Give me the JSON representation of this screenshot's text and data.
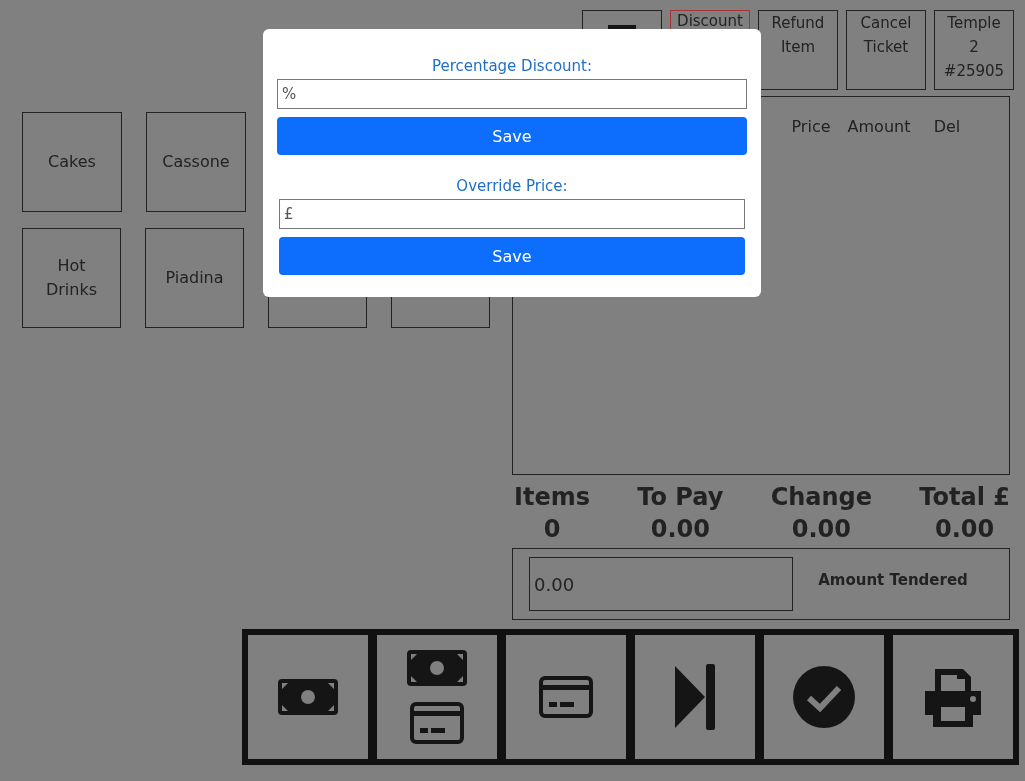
{
  "top_buttons": [
    {
      "kind": "menu"
    },
    {
      "kind": "text",
      "label": "Discount",
      "active": true
    },
    {
      "kind": "text",
      "label": "Refund Item",
      "active": false
    },
    {
      "kind": "text",
      "label": "Cancel Ticket",
      "active": false
    },
    {
      "kind": "text",
      "label": "Temple 2 #25905",
      "active": false
    }
  ],
  "category_rows": [
    [
      {
        "kind": "category",
        "label": "Cakes"
      },
      {
        "kind": "category",
        "label": "Cassone"
      }
    ],
    [
      {
        "kind": "category",
        "label": "Hot Drinks"
      },
      {
        "kind": "category",
        "label": "Piadina"
      },
      {
        "kind": "blank"
      },
      {
        "kind": "blank"
      }
    ]
  ],
  "ticket": {
    "columns": [
      "Price",
      "Amount",
      "Del"
    ]
  },
  "totals": [
    {
      "label": "Items",
      "value": "0"
    },
    {
      "label": "To Pay",
      "value": "0.00"
    },
    {
      "label": "Change",
      "value": "0.00"
    },
    {
      "label": "Total £",
      "value": "0.00"
    }
  ],
  "tendered": {
    "value": "0.00",
    "label": "Amount Tendered"
  },
  "actions": [
    {
      "kind": "cash"
    },
    {
      "kind": "split"
    },
    {
      "kind": "card"
    },
    {
      "kind": "skip"
    },
    {
      "kind": "complete"
    },
    {
      "kind": "print"
    }
  ],
  "modal": {
    "sections": [
      {
        "label": "Percentage Discount:",
        "placeholder": "%",
        "button": "Save"
      },
      {
        "label": "Override Price:",
        "placeholder": "£",
        "button": "Save"
      }
    ]
  }
}
